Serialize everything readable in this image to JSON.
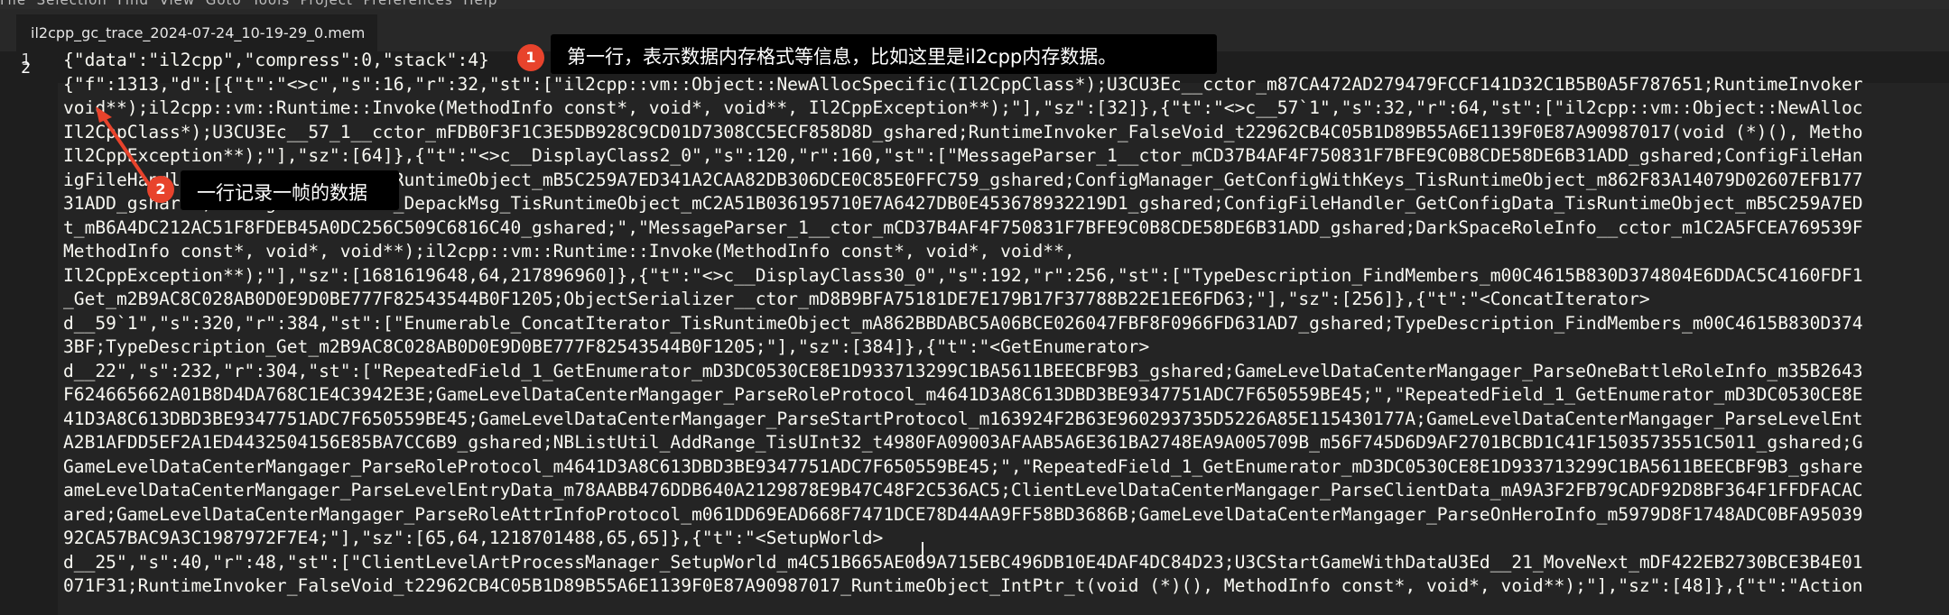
{
  "menubar": {
    "items_text": "File  Selection  Find  View  Goto  Tools  Project  Preferences  Help"
  },
  "tab": {
    "title": "il2cpp_gc_trace_2024-07-24_10-19-29_0.mem"
  },
  "gutter": {
    "line_numbers": [
      "1",
      "2"
    ]
  },
  "code": {
    "lines": [
      "{\"data\":\"il2cpp\",\"compress\":0,\"stack\":4}",
      "{\"f\":1313,\"d\":[{\"t\":\"<>c\",\"s\":16,\"r\":32,\"st\":[\"il2cpp::vm::Object::NewAllocSpecific(Il2CppClass*);U3CU3Ec__cctor_m87CA472AD279479FCCF141D32C1B5B0A5F787651;RuntimeInvoker",
      "void**);il2cpp::vm::Runtime::Invoke(MethodInfo const*, void*, void**, Il2CppException**);\"],\"sz\":[32]},{\"t\":\"<>c__57`1\",\"s\":32,\"r\":64,\"st\":[\"il2cpp::vm::Object::NewAlloc",
      "Il2CppClass*);U3CU3Ec__57_1__cctor_mFDB0F3F1C3E5DB928C9CD01D7308CC5ECF858D8D_gshared;RuntimeInvoker_FalseVoid_t22962CB4C05B1D89B55A6E1139F0E87A90987017(void (*)(), Metho",
      "Il2CppException**);\"],\"sz\":[64]},{\"t\":\"<>c__DisplayClass2_0\",\"s\":120,\"r\":160,\"st\":[\"MessageParser_1__ctor_mCD37B4AF4F750831F7BFE9C0B8CDE58DE6B31ADD_gshared;ConfigFileHan",
      "igFileHandler_GetConfigData_TisRuntimeObject_mB5C259A7ED341A2CAA82DB306DCE0C85E0FFC759_gshared;ConfigManager_GetConfigWithKeys_TisRuntimeObject_m862F83A14079D02607EFB177",
      "31ADD_gshared;ConfigFileHandler_DepackMsg_TisRuntimeObject_mC2A51B036195710E7A6427DB0E453678932219D1_gshared;ConfigFileHandler_GetConfigData_TisRuntimeObject_mB5C259A7ED",
      "t_mB6A4DC212AC51F8FDEB45A0DC256C509C6816C40_gshared;\",\"MessageParser_1__ctor_mCD37B4AF4F750831F7BFE9C0B8CDE58DE6B31ADD_gshared;DarkSpaceRoleInfo__cctor_m1C2A5FCEA769539F",
      "MethodInfo const*, void*, void**);il2cpp::vm::Runtime::Invoke(MethodInfo const*, void*, void**,",
      "Il2CppException**);\"],\"sz\":[1681619648,64,217896960]},{\"t\":\"<>c__DisplayClass30_0\",\"s\":192,\"r\":256,\"st\":[\"TypeDescription_FindMembers_m00C4615B830D374804E6DDAC5C4160FDF1",
      "_Get_m2B9AC8C028AB0D0E9D0BE777F82543544B0F1205;ObjectSerializer__ctor_mD8B9BFA75181DE7E179B17F37788B22E1EE6FD63;\"],\"sz\":[256]},{\"t\":\"<ConcatIterator>",
      "d__59`1\",\"s\":320,\"r\":384,\"st\":[\"Enumerable_ConcatIterator_TisRuntimeObject_mA862BBDABC5A06BCE026047FBF8F0966FD631AD7_gshared;TypeDescription_FindMembers_m00C4615B830D374",
      "3BF;TypeDescription_Get_m2B9AC8C028AB0D0E9D0BE777F82543544B0F1205;\"],\"sz\":[384]},{\"t\":\"<GetEnumerator>",
      "d__22\",\"s\":232,\"r\":304,\"st\":[\"RepeatedField_1_GetEnumerator_mD3DC0530CE8E1D933713299C1BA5611BEECBF9B3_gshared;GameLevelDataCenterMangager_ParseOneBattleRoleInfo_m35B2643",
      "F624665662A01B8D4DA768C1E4C3942E3E;GameLevelDataCenterMangager_ParseRoleProtocol_m4641D3A8C613DBD3BE9347751ADC7F650559BE45;\",\"RepeatedField_1_GetEnumerator_mD3DC0530CE8E",
      "41D3A8C613DBD3BE9347751ADC7F650559BE45;GameLevelDataCenterMangager_ParseStartProtocol_m163924F2B63E960293735D5226A85E115430177A;GameLevelDataCenterMangager_ParseLevelEnt",
      "A2B1AFDD5EF2A1ED4432504156E85BA7CC6B9_gshared;NBListUtil_AddRange_TisUInt32_t4980FA09003AFAAB5A6E361BA2748EA9A005709B_m56F745D6D9AF2701BCBD1C41F1503573551C5011_gshared;G",
      "GameLevelDataCenterMangager_ParseRoleProtocol_m4641D3A8C613DBD3BE9347751ADC7F650559BE45;\",\"RepeatedField_1_GetEnumerator_mD3DC0530CE8E1D933713299C1BA5611BEECBF9B3_gshare",
      "ameLevelDataCenterMangager_ParseLevelEntryData_m78AABB476DDB640A2129878E9B47C48F2C536AC5;ClientLevelDataCenterMangager_ParseClientData_mA9A3F2FB79CADF92D8BF364F1FFDFACAC",
      "ared;GameLevelDataCenterMangager_ParseRoleAttrInfoProtocol_m061DD69EAD668F7471DCE78D44AA9FF58BD3686B;GameLevelDataCenterMangager_ParseOnHeroInfo_m5979D8F1748ADC0BFA95039",
      "92CA57BAC9A3C1987972F7E4;\"],\"sz\":[65,64,1218701488,65,65]},{\"t\":\"<SetupWorld>",
      "d__25\",\"s\":40,\"r\":48,\"st\":[\"ClientLevelArtProcessManager_SetupWorld_m4C51B665AE069A715EBC496DB10E4DAF4DC84D23;U3CStartGameWithDataU3Ed__21_MoveNext_mDF422EB2730BCE3B4E01",
      "071F31;RuntimeInvoker_FalseVoid_t22962CB4C05B1D89B55A6E1139F0E87A90987017_RuntimeObject_IntPtr_t(void (*)(), MethodInfo const*, void*, void**);\"],\"sz\":[48]},{\"t\":\"Action"
    ]
  },
  "annotations": [
    {
      "number": "1",
      "text": "第一行，表示数据内存格式等信息，比如这里是il2cpp内存数据。"
    },
    {
      "number": "2",
      "text": "一行记录一帧的数据"
    }
  ],
  "colors": {
    "editor_bg": "#1e1e1e",
    "code_text": "#f8f8f2",
    "badge": "#e8432c",
    "tooltip_bg": "#000000"
  }
}
